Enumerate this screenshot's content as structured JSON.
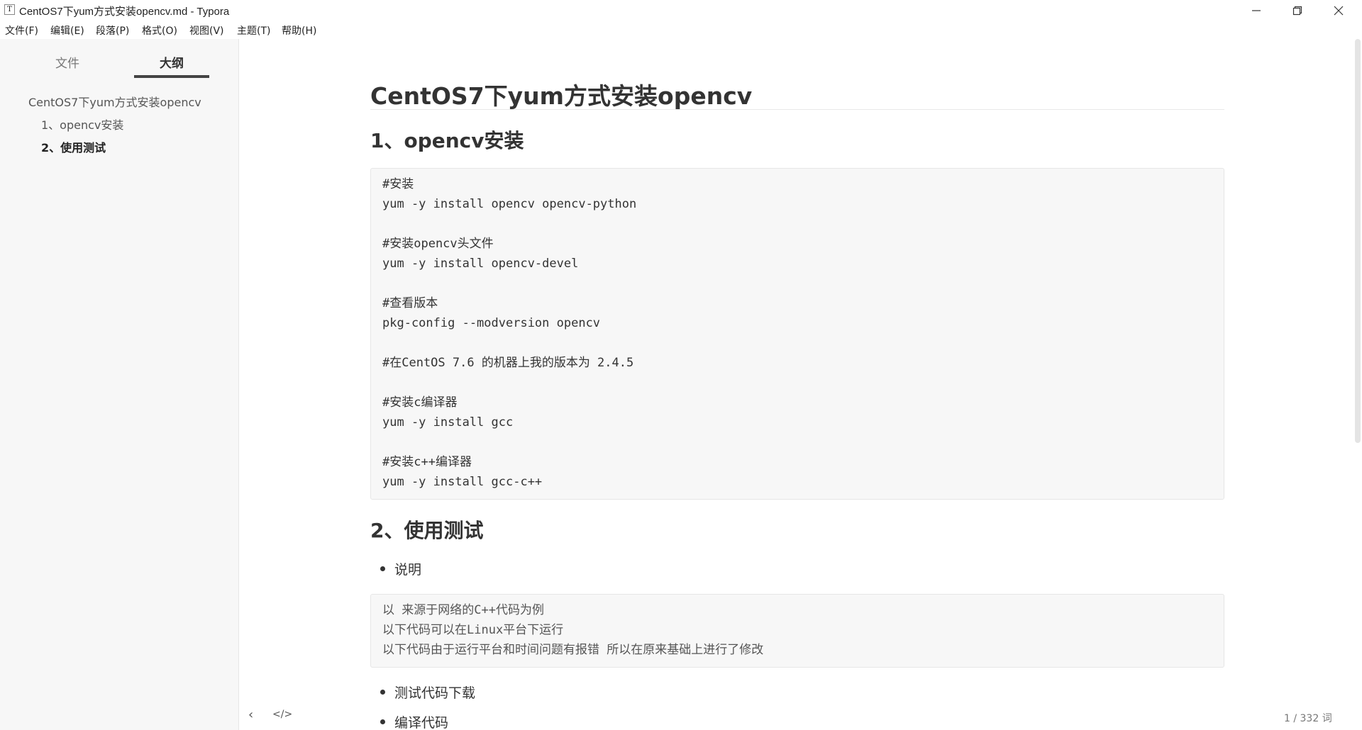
{
  "window": {
    "app_icon_glyph": "T",
    "title": "CentOS7下yum方式安装opencv.md - Typora",
    "controls": {
      "minimize": "minimize-icon",
      "maximize": "restore-icon",
      "close": "close-icon"
    }
  },
  "menu": [
    "文件(F)",
    "编辑(E)",
    "段落(P)",
    "格式(O)",
    "视图(V)",
    "主题(T)",
    "帮助(H)"
  ],
  "sidebar": {
    "tabs": [
      "文件",
      "大纲"
    ],
    "active_tab": "大纲",
    "outline": [
      {
        "label": "CentOS7下yum方式安装opencv",
        "level": 1
      },
      {
        "label": "1、opencv安装",
        "level": 2
      },
      {
        "label": "2、使用测试",
        "level": 2,
        "active": true
      }
    ]
  },
  "document": {
    "title": "CentOS7下yum方式安装opencv",
    "section1": {
      "heading": "1、opencv安装",
      "code": [
        "#安装",
        "yum -y install opencv opencv-python",
        "",
        "#安装opencv头文件",
        "yum -y install opencv-devel",
        "",
        "#查看版本",
        "pkg-config --modversion opencv",
        "",
        "#在CentOS 7.6 的机器上我的版本为 2.4.5",
        "",
        "#安装c编译器",
        "yum -y install gcc",
        "",
        "#安装c++编译器",
        "yum -y install gcc-c++"
      ]
    },
    "section2": {
      "heading": "2、使用测试",
      "bullets": [
        "说明",
        "测试代码下载",
        "编译代码"
      ],
      "note": [
        "以 来源于网络的C++代码为例",
        "以下代码可以在Linux平台下运行",
        "以下代码由于运行平台和时间问题有报错 所以在原来基础上进行了修改"
      ]
    }
  },
  "footer": {
    "back_icon": "chevron-left-icon",
    "source_icon": "code-icon",
    "word_count": "1 / 332 词"
  }
}
